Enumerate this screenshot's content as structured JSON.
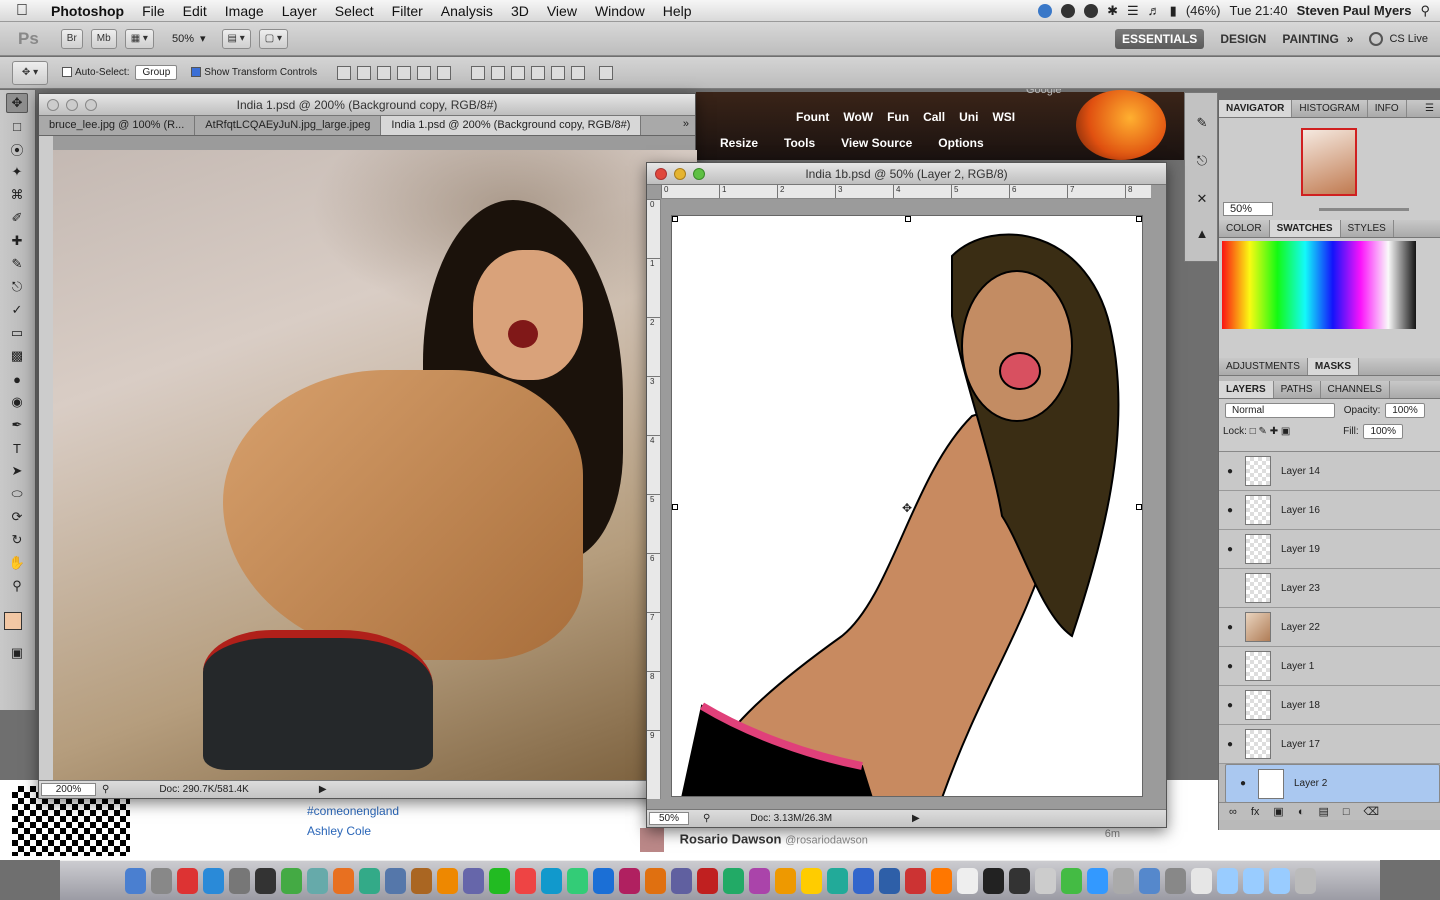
{
  "menubar": {
    "app_name": "Photoshop",
    "items": [
      "File",
      "Edit",
      "Image",
      "Layer",
      "Select",
      "Filter",
      "Analysis",
      "3D",
      "View",
      "Window",
      "Help"
    ],
    "battery": "(46%)",
    "clock": "Tue 21:40",
    "user": "Steven Paul Myers"
  },
  "appbar": {
    "ps_logo": "Ps",
    "br": "Br",
    "mb": "Mb",
    "zoom": "50%",
    "workspaces": [
      "ESSENTIALS",
      "DESIGN",
      "PAINTING"
    ],
    "more": "»",
    "cs_live": "CS Live"
  },
  "options": {
    "auto_select_label": "Auto-Select:",
    "auto_select_value": "Group",
    "show_transform_label": "Show Transform Controls"
  },
  "doc1": {
    "title": "India 1.psd @ 200% (Background copy, RGB/8#)",
    "tabs": [
      "bruce_lee.jpg @ 100% (R...",
      "AtRfqtLCQAEyJuN.jpg_large.jpeg",
      "India 1.psd @ 200% (Background copy, RGB/8#)"
    ],
    "zoom": "200%",
    "doc_size": "Doc: 290.7K/581.4K"
  },
  "doc2": {
    "title": "India 1b.psd @ 50% (Layer 2, RGB/8)",
    "zoom": "50%",
    "doc_size": "Doc: 3.13M/26.3M",
    "ruler_top": [
      "0",
      "1",
      "2",
      "3",
      "4",
      "5",
      "6",
      "7",
      "8"
    ],
    "ruler_left": [
      "0",
      "1",
      "2",
      "3",
      "4",
      "5",
      "6",
      "7",
      "8",
      "9"
    ]
  },
  "browser_toolbar": {
    "row1": [
      "Fount",
      "WoW",
      "Fun",
      "Call",
      "Uni",
      "WSI"
    ],
    "row2": [
      "Resize",
      "Tools",
      "View Source",
      "Options"
    ],
    "search_hint": "Google"
  },
  "panels": {
    "nav_tabs": [
      "NAVIGATOR",
      "HISTOGRAM",
      "INFO"
    ],
    "nav_zoom": "50%",
    "color_tabs": [
      "COLOR",
      "SWATCHES",
      "STYLES"
    ],
    "adj_tabs": [
      "ADJUSTMENTS",
      "MASKS"
    ],
    "layer_tabs": [
      "LAYERS",
      "PATHS",
      "CHANNELS"
    ],
    "blend_mode": "Normal",
    "opacity_label": "Opacity:",
    "opacity": "100%",
    "lock_label": "Lock:",
    "fill_label": "Fill:",
    "fill": "100%",
    "layers": [
      {
        "name": "Layer 14",
        "visible": true,
        "thumb": "trans"
      },
      {
        "name": "Layer 16",
        "visible": true,
        "thumb": "trans"
      },
      {
        "name": "Layer 19",
        "visible": true,
        "thumb": "trans"
      },
      {
        "name": "Layer 23",
        "visible": false,
        "thumb": "trans"
      },
      {
        "name": "Layer 22",
        "visible": true,
        "thumb": "img"
      },
      {
        "name": "Layer 1",
        "visible": true,
        "thumb": "trans"
      },
      {
        "name": "Layer 18",
        "visible": true,
        "thumb": "trans"
      },
      {
        "name": "Layer 17",
        "visible": true,
        "thumb": "trans"
      },
      {
        "name": "Layer 2",
        "visible": true,
        "thumb": "white",
        "selected": true
      }
    ]
  },
  "background_web": {
    "hashtag": "#comeonengland",
    "name_link": "Ashley Cole",
    "tweet_name": "Rosario Dawson",
    "tweet_handle": "@rosariodawson",
    "tweet_time": "6m"
  },
  "dock": {
    "icons": [
      "finder",
      "rocket",
      "ical",
      "safari",
      "system-prefs",
      "dashboard",
      "time-machine",
      "preview",
      "firefox",
      "chrome",
      "network",
      "wow",
      "vlc",
      "itunes",
      "spotify",
      "klout",
      "skype",
      "drive",
      "ps",
      "id",
      "ai",
      "ae",
      "fl",
      "dw",
      "fw",
      "vlc2",
      "fruit",
      "fish",
      "ff2",
      "word",
      "skitch",
      "ff3",
      "pages",
      "terminal",
      "p",
      "calc",
      "spring",
      "twitter",
      "phone",
      "chat",
      "fan",
      "home",
      "folder1",
      "folder2",
      "folder3",
      "trash"
    ]
  },
  "colors": {
    "accent": "#3b6fd6",
    "selected_layer": "#aac8f0",
    "skin": "#d9a27a",
    "hair": "#3a2d14"
  }
}
